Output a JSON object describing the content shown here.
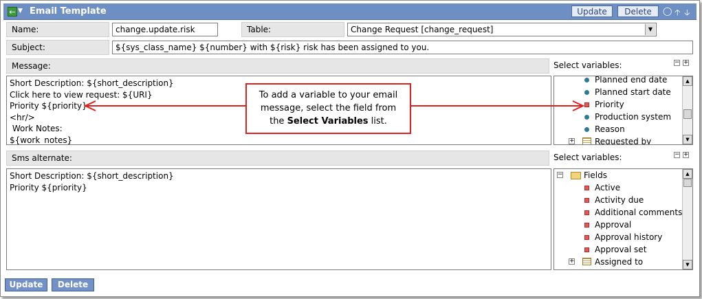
{
  "header": {
    "title": "Email Template",
    "update_label": "Update",
    "delete_label": "Delete"
  },
  "form": {
    "name_label": "Name:",
    "name_value": "change.update.risk",
    "table_label": "Table:",
    "table_value": "Change Request [change_request]",
    "subject_label": "Subject:",
    "subject_value": "${sys_class_name} ${number} with ${risk} risk has been assigned to you.",
    "message_label": "Message:",
    "message_lines": [
      "Short Description: ${short_description}",
      "Click here to view request: ${URI}",
      "Priority ${priority}",
      "<hr/>",
      " Work Notes:",
      "${work_notes}"
    ],
    "sms_label": "Sms alternate:",
    "sms_lines": [
      "Short Description: ${short_description}",
      "Priority ${priority}"
    ]
  },
  "variables_top": {
    "label": "Select variables:",
    "items": [
      {
        "label": "Planned end date",
        "icon": "dot-icon"
      },
      {
        "label": "Planned start date",
        "icon": "dot-icon"
      },
      {
        "label": "Priority",
        "icon": "square-icon"
      },
      {
        "label": "Production system",
        "icon": "dot-icon"
      },
      {
        "label": "Reason",
        "icon": "dot-icon"
      },
      {
        "label": "Requested by",
        "icon": "table-icon"
      }
    ]
  },
  "variables_bottom": {
    "label": "Select variables:",
    "fields_label": "Fields",
    "items": [
      {
        "label": "Active",
        "icon": "square-icon"
      },
      {
        "label": "Activity due",
        "icon": "square-icon"
      },
      {
        "label": "Additional comments",
        "icon": "square-icon"
      },
      {
        "label": "Approval",
        "icon": "square-icon"
      },
      {
        "label": "Approval history",
        "icon": "square-icon"
      },
      {
        "label": "Approval set",
        "icon": "square-icon"
      },
      {
        "label": "Assigned to",
        "icon": "table-icon"
      }
    ]
  },
  "callout": {
    "line1": "To add a variable to your email",
    "line2": "message, select the field from",
    "line3_pre": "the ",
    "line3_bold": "Select Variables",
    "line3_post": " list."
  },
  "footer": {
    "update_label": "Update",
    "delete_label": "Delete"
  },
  "colors": {
    "titlebar": "#6d8fc3",
    "callout_border": "#e02020",
    "button_bg": "#7391c6"
  }
}
